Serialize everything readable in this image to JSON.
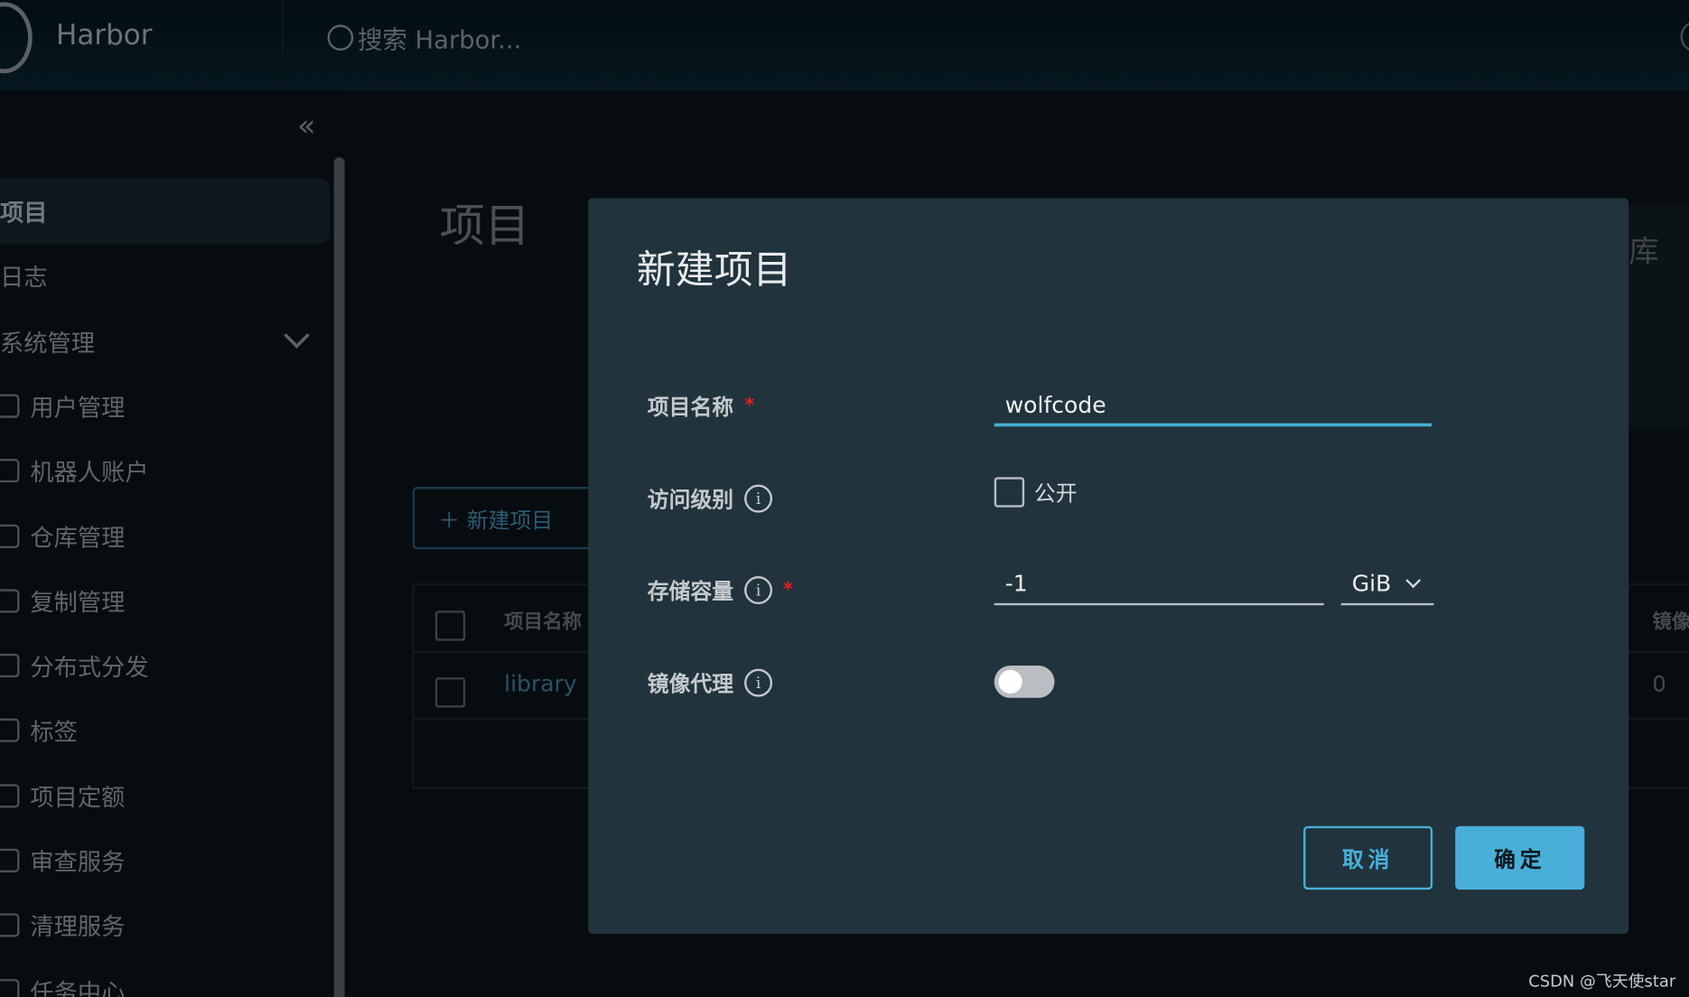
{
  "header": {
    "brand": "Harbor",
    "search_placeholder": "搜索 Harbor..."
  },
  "sidebar": {
    "items": [
      {
        "label": "项目",
        "active": true
      },
      {
        "label": "日志"
      },
      {
        "label": "系统管理",
        "expandable": true
      },
      {
        "label": "用户管理",
        "icon": "users-icon"
      },
      {
        "label": "机器人账户",
        "icon": "robot-icon"
      },
      {
        "label": "仓库管理",
        "icon": "cube-icon"
      },
      {
        "label": "复制管理",
        "icon": "cloud-icon"
      },
      {
        "label": "分布式分发",
        "icon": "share-icon"
      },
      {
        "label": "标签",
        "icon": "tag-icon"
      },
      {
        "label": "项目定额",
        "icon": "pie-icon"
      },
      {
        "label": "审查服务",
        "icon": "shield-icon"
      },
      {
        "label": "清理服务",
        "icon": "trash-icon"
      },
      {
        "label": "任务中心",
        "icon": "clock-icon"
      }
    ]
  },
  "background": {
    "title": "项目",
    "new_project": "＋ 新建项目",
    "col_name": "项目名称",
    "col_mirror": "镜像",
    "row_name": "library",
    "row_count": "0",
    "right_card": "库"
  },
  "modal": {
    "title": "新建项目",
    "name_label": "项目名称",
    "name_value": "wolfcode",
    "access_label": "访问级别",
    "public_label": "公开",
    "public_checked": false,
    "storage_label": "存储容量",
    "storage_value": "-1",
    "storage_unit": "GiB",
    "proxy_label": "镜像代理",
    "proxy_enabled": false,
    "required_mark": "*",
    "info_glyph": "i",
    "cancel": "取消",
    "ok": "确定"
  },
  "colors": {
    "accent": "#49afd9",
    "modal_bg": "#21333c"
  },
  "watermark": "CSDN @飞天使star"
}
